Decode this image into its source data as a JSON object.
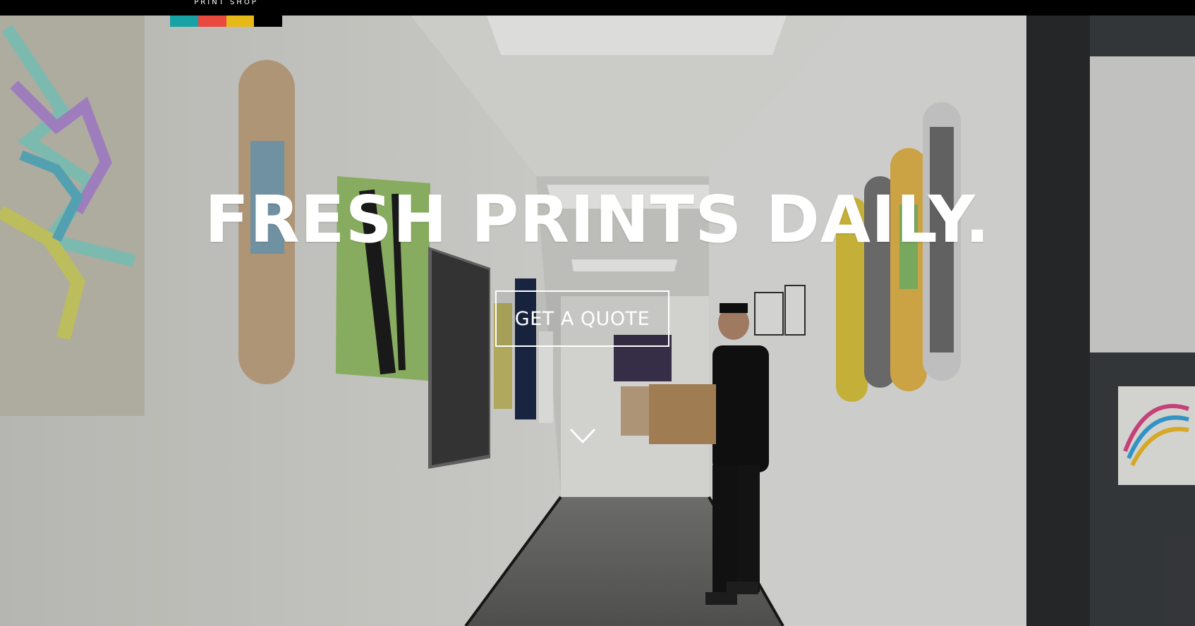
{
  "brand": {
    "logo_text": "PRINT SHOP",
    "logo_colors": [
      "#17a3a6",
      "#e9493f",
      "#e6b917",
      "#000000"
    ]
  },
  "hero": {
    "headline": "FRESH PRINTS DAILY.",
    "cta_label": "GET A QUOTE",
    "scroll_icon": "chevron-down-icon"
  },
  "colors": {
    "text": "#ffffff",
    "topbar": "#000000"
  }
}
